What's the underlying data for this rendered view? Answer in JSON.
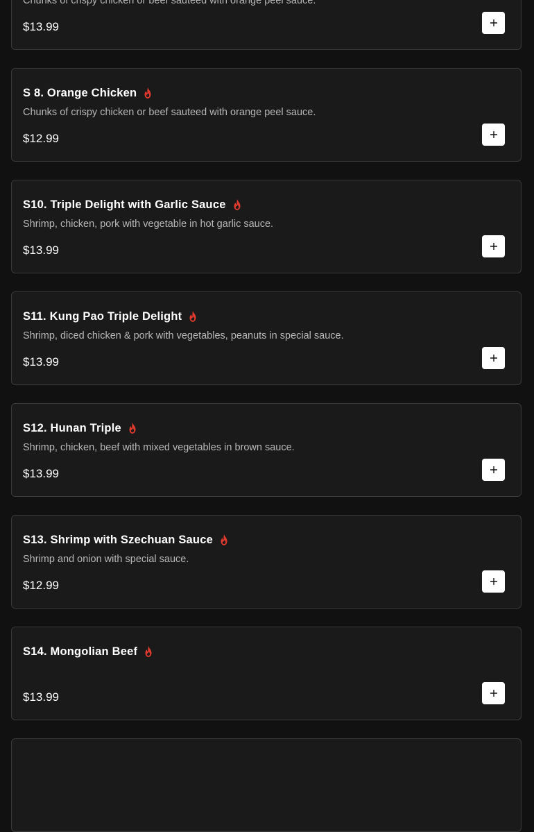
{
  "menu": {
    "accent_color": "#e03a2f",
    "items": [
      {
        "title": "",
        "description": "Chunks of crispy chicken or beef sauteed with orange peel sauce.",
        "price": "$13.99",
        "spicy_icon": "flame-icon",
        "add_icon": "plus-icon"
      },
      {
        "title": "S 8. Orange Chicken",
        "description": "Chunks of crispy chicken or beef sauteed with orange peel sauce.",
        "price": "$12.99",
        "spicy_icon": "flame-icon",
        "add_icon": "plus-icon"
      },
      {
        "title": "S10. Triple Delight with Garlic Sauce",
        "description": "Shrimp, chicken, pork with vegetable in hot garlic sauce.",
        "price": "$13.99",
        "spicy_icon": "flame-icon",
        "add_icon": "plus-icon"
      },
      {
        "title": "S11. Kung Pao Triple Delight",
        "description": "Shrimp, diced chicken & pork with vegetables, peanuts in special sauce.",
        "price": "$13.99",
        "spicy_icon": "flame-icon",
        "add_icon": "plus-icon"
      },
      {
        "title": "S12. Hunan Triple",
        "description": "Shrimp, chicken, beef with mixed vegetables in brown sauce.",
        "price": "$13.99",
        "spicy_icon": "flame-icon",
        "add_icon": "plus-icon"
      },
      {
        "title": "S13. Shrimp with Szechuan Sauce",
        "description": "Shrimp and onion with special sauce.",
        "price": "$12.99",
        "spicy_icon": "flame-icon",
        "add_icon": "plus-icon"
      },
      {
        "title": "S14. Mongolian Beef",
        "description": "",
        "price": "$13.99",
        "spicy_icon": "flame-icon",
        "add_icon": "plus-icon"
      }
    ]
  }
}
